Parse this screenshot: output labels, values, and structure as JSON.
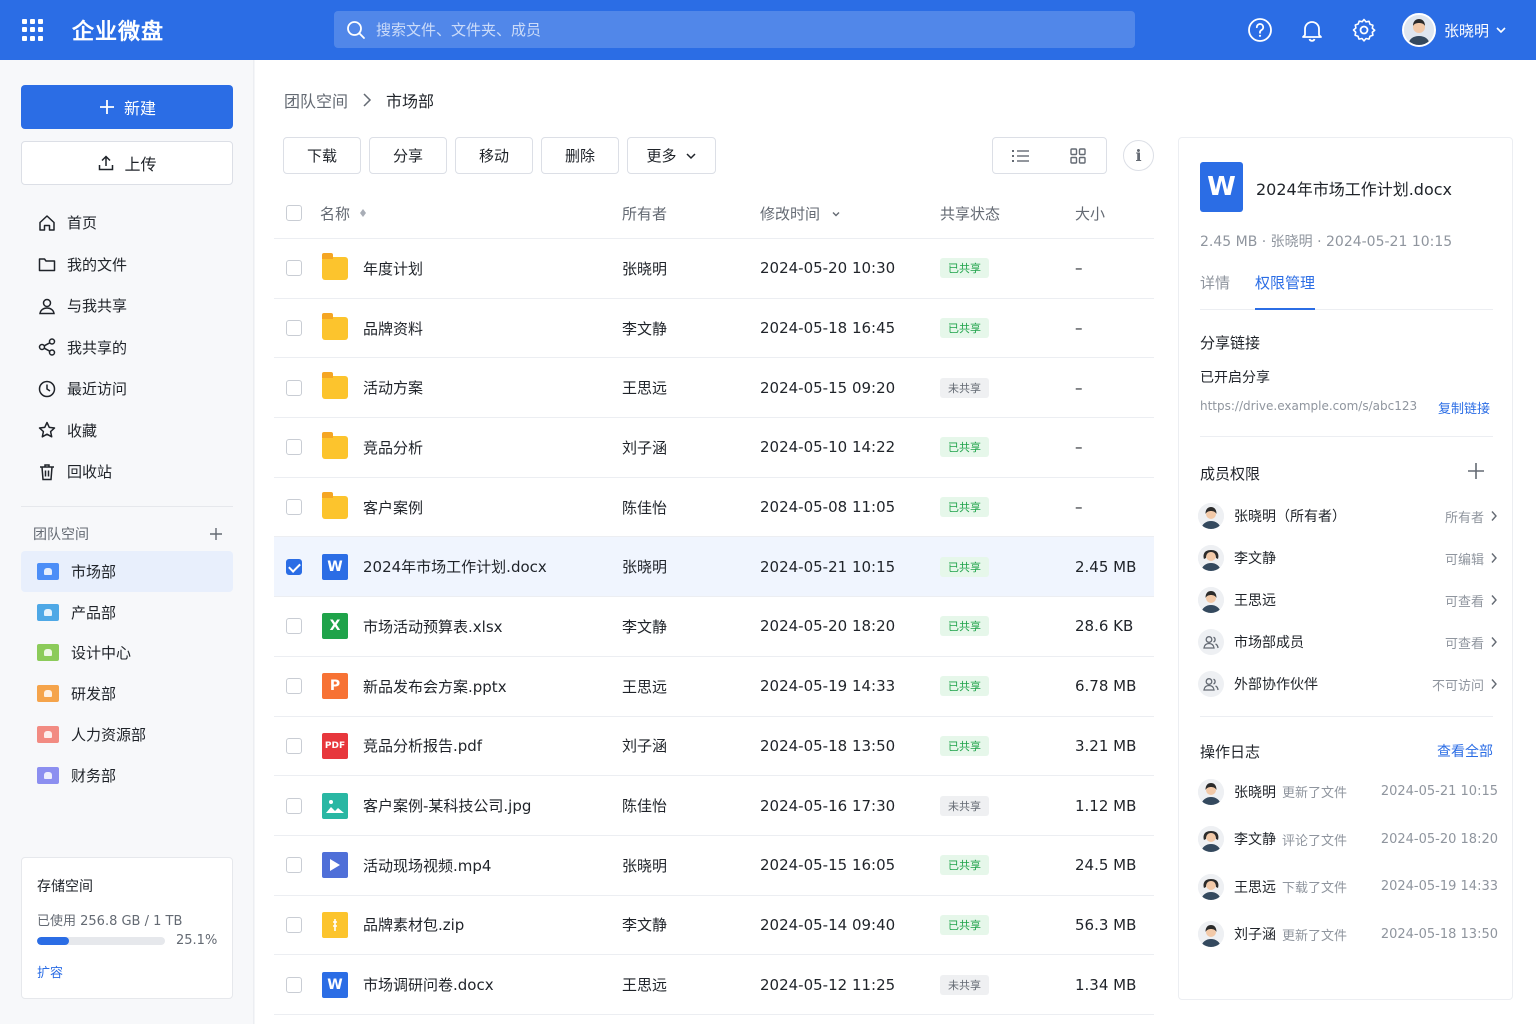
{
  "header": {
    "app_name": "企业微盘",
    "search_placeholder": "搜索文件、文件夹、成员",
    "user_name": "张晓明"
  },
  "sidebar": {
    "new_label": "新建",
    "upload_label": "上传",
    "nav": [
      {
        "label": "首页",
        "icon": "home-icon"
      },
      {
        "label": "我的文件",
        "icon": "folder-icon"
      },
      {
        "label": "与我共享",
        "icon": "user-icon"
      },
      {
        "label": "我共享的",
        "icon": "share-icon"
      },
      {
        "label": "最近访问",
        "icon": "clock-icon"
      },
      {
        "label": "收藏",
        "icon": "star-icon"
      },
      {
        "label": "回收站",
        "icon": "trash-icon"
      }
    ],
    "team_title": "团队空间",
    "teams": [
      {
        "label": "市场部",
        "color": "#4c8ef7",
        "active": true
      },
      {
        "label": "产品部",
        "color": "#4ea8e6",
        "active": false
      },
      {
        "label": "设计中心",
        "color": "#8ccb5a",
        "active": false
      },
      {
        "label": "研发部",
        "color": "#f5a44b",
        "active": false
      },
      {
        "label": "人力资源部",
        "color": "#f28b82",
        "active": false
      },
      {
        "label": "财务部",
        "color": "#8c8ff0",
        "active": false
      }
    ],
    "storage": {
      "title": "存储空间",
      "used_text": "已使用 256.8 GB / 1 TB",
      "percent_text": "25.1%",
      "percent": 25.1,
      "expand_label": "扩容"
    }
  },
  "breadcrumb": {
    "parent": "团队空间",
    "current": "市场部"
  },
  "toolbar": {
    "download": "下载",
    "share": "分享",
    "move": "移动",
    "delete": "删除",
    "more": "更多"
  },
  "table": {
    "headers": {
      "name": "名称",
      "owner": "所有者",
      "modified": "修改时间",
      "share_status": "共享状态",
      "size": "大小"
    },
    "rows": [
      {
        "name": "年度计划",
        "type": "folder",
        "owner": "张晓明",
        "time": "2024-05-20 10:30",
        "share": "已共享",
        "shared": true,
        "size": "–",
        "selected": false
      },
      {
        "name": "品牌资料",
        "type": "folder",
        "owner": "李文静",
        "time": "2024-05-18 16:45",
        "share": "已共享",
        "shared": true,
        "size": "–",
        "selected": false
      },
      {
        "name": "活动方案",
        "type": "folder",
        "owner": "王思远",
        "time": "2024-05-15 09:20",
        "share": "未共享",
        "shared": false,
        "size": "–",
        "selected": false
      },
      {
        "name": "竞品分析",
        "type": "folder",
        "owner": "刘子涵",
        "time": "2024-05-10 14:22",
        "share": "已共享",
        "shared": true,
        "size": "–",
        "selected": false
      },
      {
        "name": "客户案例",
        "type": "folder",
        "owner": "陈佳怡",
        "time": "2024-05-08 11:05",
        "share": "已共享",
        "shared": true,
        "size": "–",
        "selected": false
      },
      {
        "name": "2024年市场工作计划.docx",
        "type": "doc",
        "owner": "张晓明",
        "time": "2024-05-21 10:15",
        "share": "已共享",
        "shared": true,
        "size": "2.45 MB",
        "selected": true
      },
      {
        "name": "市场活动预算表.xlsx",
        "type": "xls",
        "owner": "李文静",
        "time": "2024-05-20 18:20",
        "share": "已共享",
        "shared": true,
        "size": "28.6 KB",
        "selected": false
      },
      {
        "name": "新品发布会方案.pptx",
        "type": "ppt",
        "owner": "王思远",
        "time": "2024-05-19 14:33",
        "share": "已共享",
        "shared": true,
        "size": "6.78 MB",
        "selected": false
      },
      {
        "name": "竞品分析报告.pdf",
        "type": "pdf",
        "owner": "刘子涵",
        "time": "2024-05-18 13:50",
        "share": "已共享",
        "shared": true,
        "size": "3.21 MB",
        "selected": false
      },
      {
        "name": "客户案例-某科技公司.jpg",
        "type": "img",
        "owner": "陈佳怡",
        "time": "2024-05-16 17:30",
        "share": "未共享",
        "shared": false,
        "size": "1.12 MB",
        "selected": false
      },
      {
        "name": "活动现场视频.mp4",
        "type": "vid",
        "owner": "张晓明",
        "time": "2024-05-15 16:05",
        "share": "已共享",
        "shared": true,
        "size": "24.5 MB",
        "selected": false
      },
      {
        "name": "品牌素材包.zip",
        "type": "zip",
        "owner": "李文静",
        "time": "2024-05-14 09:40",
        "share": "已共享",
        "shared": true,
        "size": "56.3 MB",
        "selected": false
      },
      {
        "name": "市场调研问卷.docx",
        "type": "doc",
        "owner": "王思远",
        "time": "2024-05-12 11:25",
        "share": "未共享",
        "shared": false,
        "size": "1.34 MB",
        "selected": false
      }
    ]
  },
  "panel": {
    "file_icon_letter": "W",
    "file_name": "2024年市场工作计划.docx",
    "meta": "2.45 MB · 张晓明 · 2024-05-21 10:15",
    "tabs": [
      "详情",
      "权限管理"
    ],
    "share_link_title": "分享链接",
    "share_status": "已开启分享",
    "share_url": "https://drive.example.com/s/abc123",
    "copy_link": "复制链接",
    "members_title": "成员权限",
    "members": [
      {
        "name": "张晓明（所有者）",
        "role": "所有者",
        "kind": "person"
      },
      {
        "name": "李文静",
        "role": "可编辑",
        "kind": "person-f"
      },
      {
        "name": "王思远",
        "role": "可查看",
        "kind": "person"
      },
      {
        "name": "市场部成员",
        "role": "可查看",
        "kind": "group"
      },
      {
        "name": "外部协作伙伴",
        "role": "不可访问",
        "kind": "group"
      }
    ],
    "log_title": "操作日志",
    "view_all": "查看全部",
    "logs": [
      {
        "name": "张晓明",
        "action": "更新了文件",
        "time": "2024-05-21 10:15",
        "kind": "person"
      },
      {
        "name": "李文静",
        "action": "评论了文件",
        "time": "2024-05-20 18:20",
        "kind": "person-f"
      },
      {
        "name": "王思远",
        "action": "下载了文件",
        "time": "2024-05-19 14:33",
        "kind": "person-f"
      },
      {
        "name": "刘子涵",
        "action": "更新了文件",
        "time": "2024-05-18 13:50",
        "kind": "person"
      }
    ]
  }
}
